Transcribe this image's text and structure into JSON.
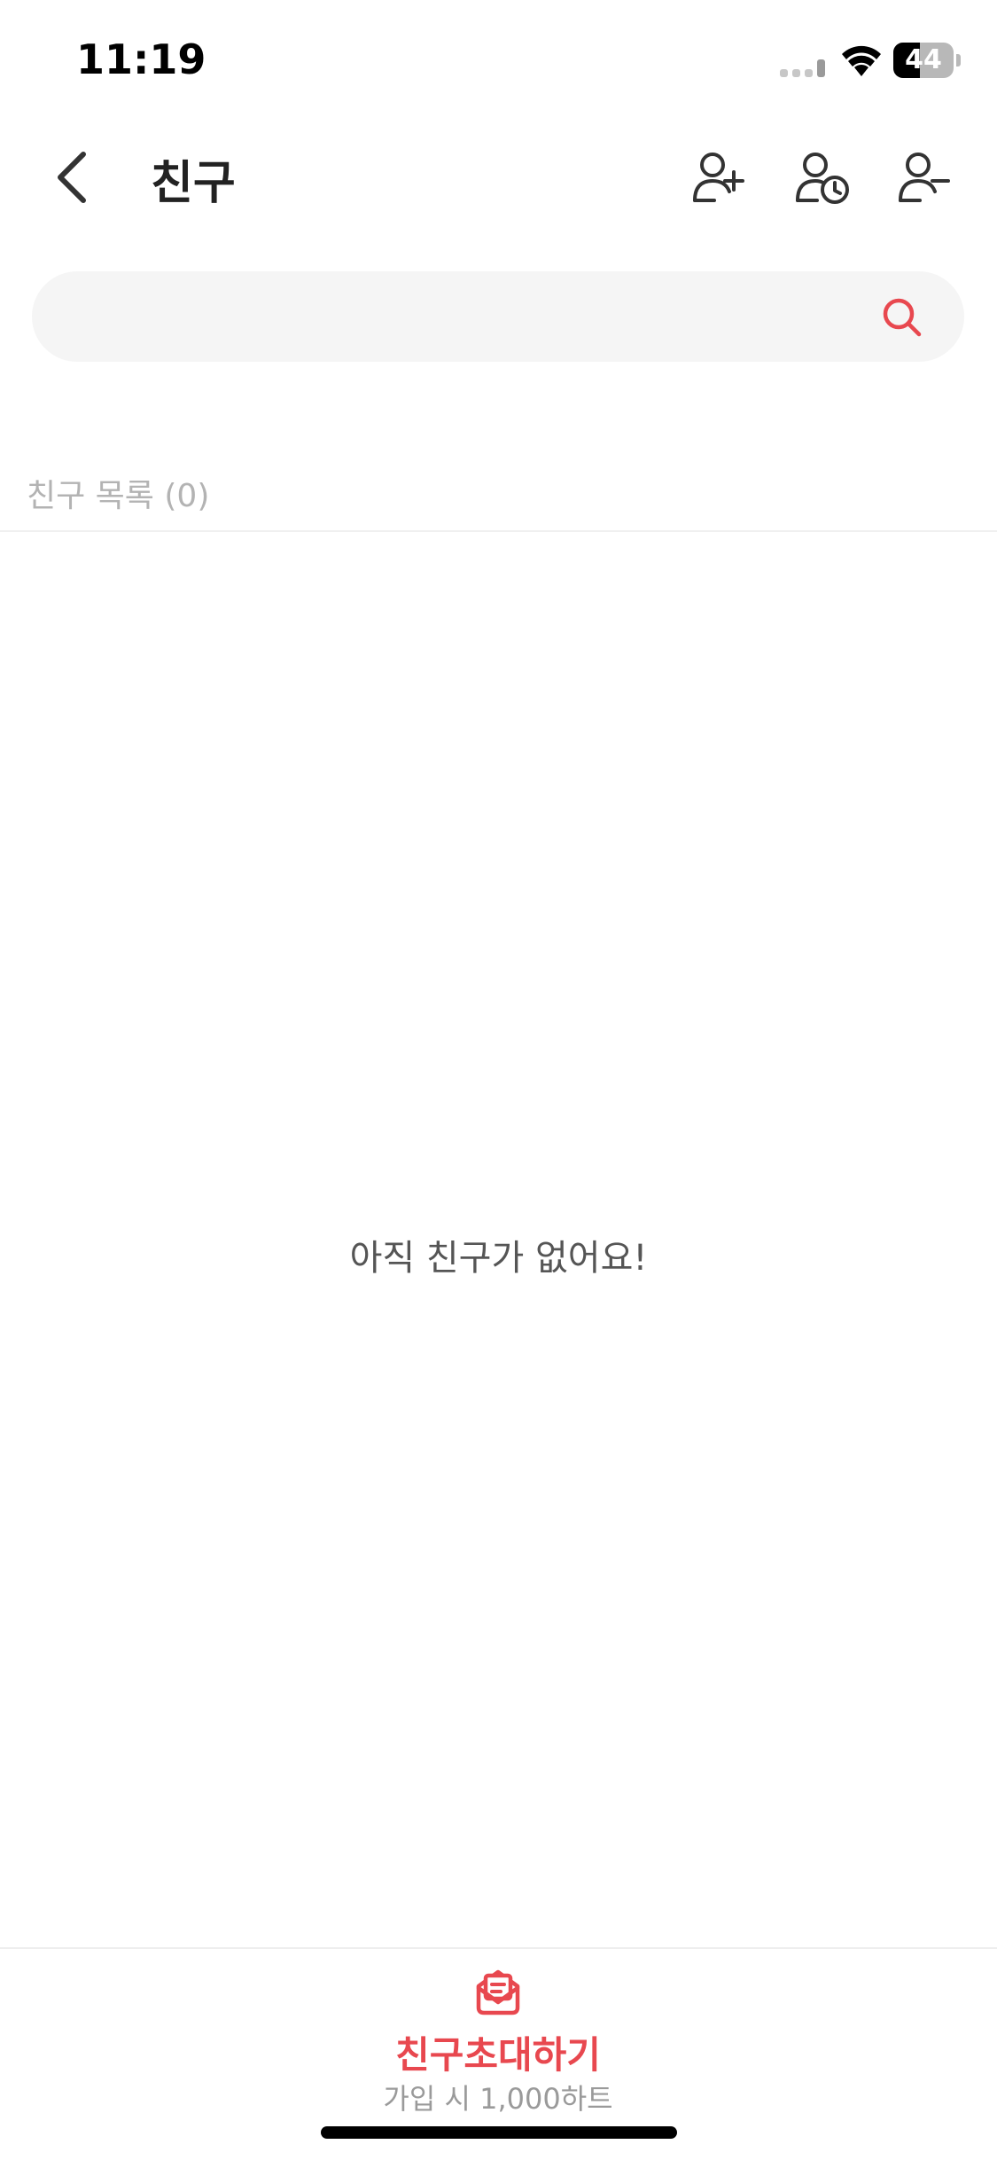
{
  "status_bar": {
    "time": "11:19",
    "battery_level": "44",
    "battery_fraction": 0.44
  },
  "header": {
    "title": "친구",
    "icons": {
      "back": "chevron-left-icon",
      "add_friend": "user-plus-icon",
      "pending_friend": "user-clock-icon",
      "remove_friend": "user-minus-icon"
    }
  },
  "search": {
    "value": "",
    "placeholder": "",
    "icon": "search-icon"
  },
  "friends_list": {
    "header": "친구 목록 (0)",
    "empty_message": "아직 친구가 없어요!"
  },
  "bottom_bar": {
    "invite_label": "친구초대하기",
    "invite_sublabel": "가입 시 1,000하트",
    "invite_icon": "mail-open-icon"
  },
  "colors": {
    "accent": "#e8484f",
    "text_primary": "#222222",
    "text_muted": "#b3b3b3",
    "search_background": "#f5f5f5"
  }
}
